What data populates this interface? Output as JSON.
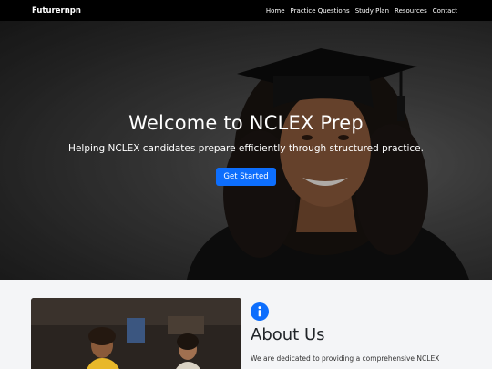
{
  "nav": {
    "brand": "Futurernpn",
    "links": [
      "Home",
      "Practice Questions",
      "Study Plan",
      "Resources",
      "Contact"
    ]
  },
  "hero": {
    "title": "Welcome to NCLEX Prep",
    "subtitle": "Helping NCLEX candidates prepare efficiently through structured practice.",
    "button_label": "Get Started"
  },
  "about": {
    "icon": "info-circle-icon",
    "title": "About Us",
    "text": "We are dedicated to providing a comprehensive NCLEX"
  },
  "colors": {
    "navbar_bg": "#000000",
    "accent": "#0d6efd",
    "page_bg": "#f4f5f7"
  }
}
